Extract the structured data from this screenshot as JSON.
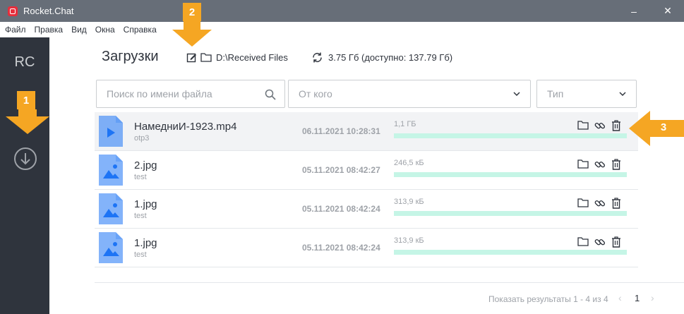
{
  "window": {
    "title": "Rocket.Chat",
    "controls": {
      "minimize": "–",
      "maximize": "☐",
      "close": "✕"
    }
  },
  "menu": [
    "Файл",
    "Правка",
    "Вид",
    "Окна",
    "Справка"
  ],
  "sidebar": {
    "logo": "RC",
    "downloads_icon": "download-circle-icon"
  },
  "header": {
    "title": "Загрузки",
    "path": "D:\\Received Files",
    "storage": "3.75 Гб (доступно: 137.79 Гб)"
  },
  "filters": {
    "search_placeholder": "Поиск по имени файла",
    "from_placeholder": "От кого",
    "type_placeholder": "Тип"
  },
  "files": [
    {
      "name": "НамедниИ-1923.mp4",
      "from": "otp3",
      "date": "06.11.2021 10:28:31",
      "size": "1,1 ГБ",
      "kind": "video",
      "progress": 1.0
    },
    {
      "name": "2.jpg",
      "from": "test",
      "date": "05.11.2021 08:42:27",
      "size": "246,5 кБ",
      "kind": "image",
      "progress": 1.0
    },
    {
      "name": "1.jpg",
      "from": "test",
      "date": "05.11.2021 08:42:24",
      "size": "313,9 кБ",
      "kind": "image",
      "progress": 1.0
    },
    {
      "name": "1.jpg",
      "from": "test",
      "date": "05.11.2021 08:42:24",
      "size": "313,9 кБ",
      "kind": "image",
      "progress": 1.0
    }
  ],
  "pager": {
    "text": "Показать результаты 1 - 4 из 4",
    "page": "1",
    "prev": "‹",
    "next": "›"
  },
  "callouts": [
    "1",
    "2",
    "3"
  ],
  "colors": {
    "accent": "#f5a623",
    "progress": "#c5f5e6",
    "sidebar": "#2f343d",
    "titlebar": "#676e78",
    "file_icon": "#1d74f5"
  }
}
